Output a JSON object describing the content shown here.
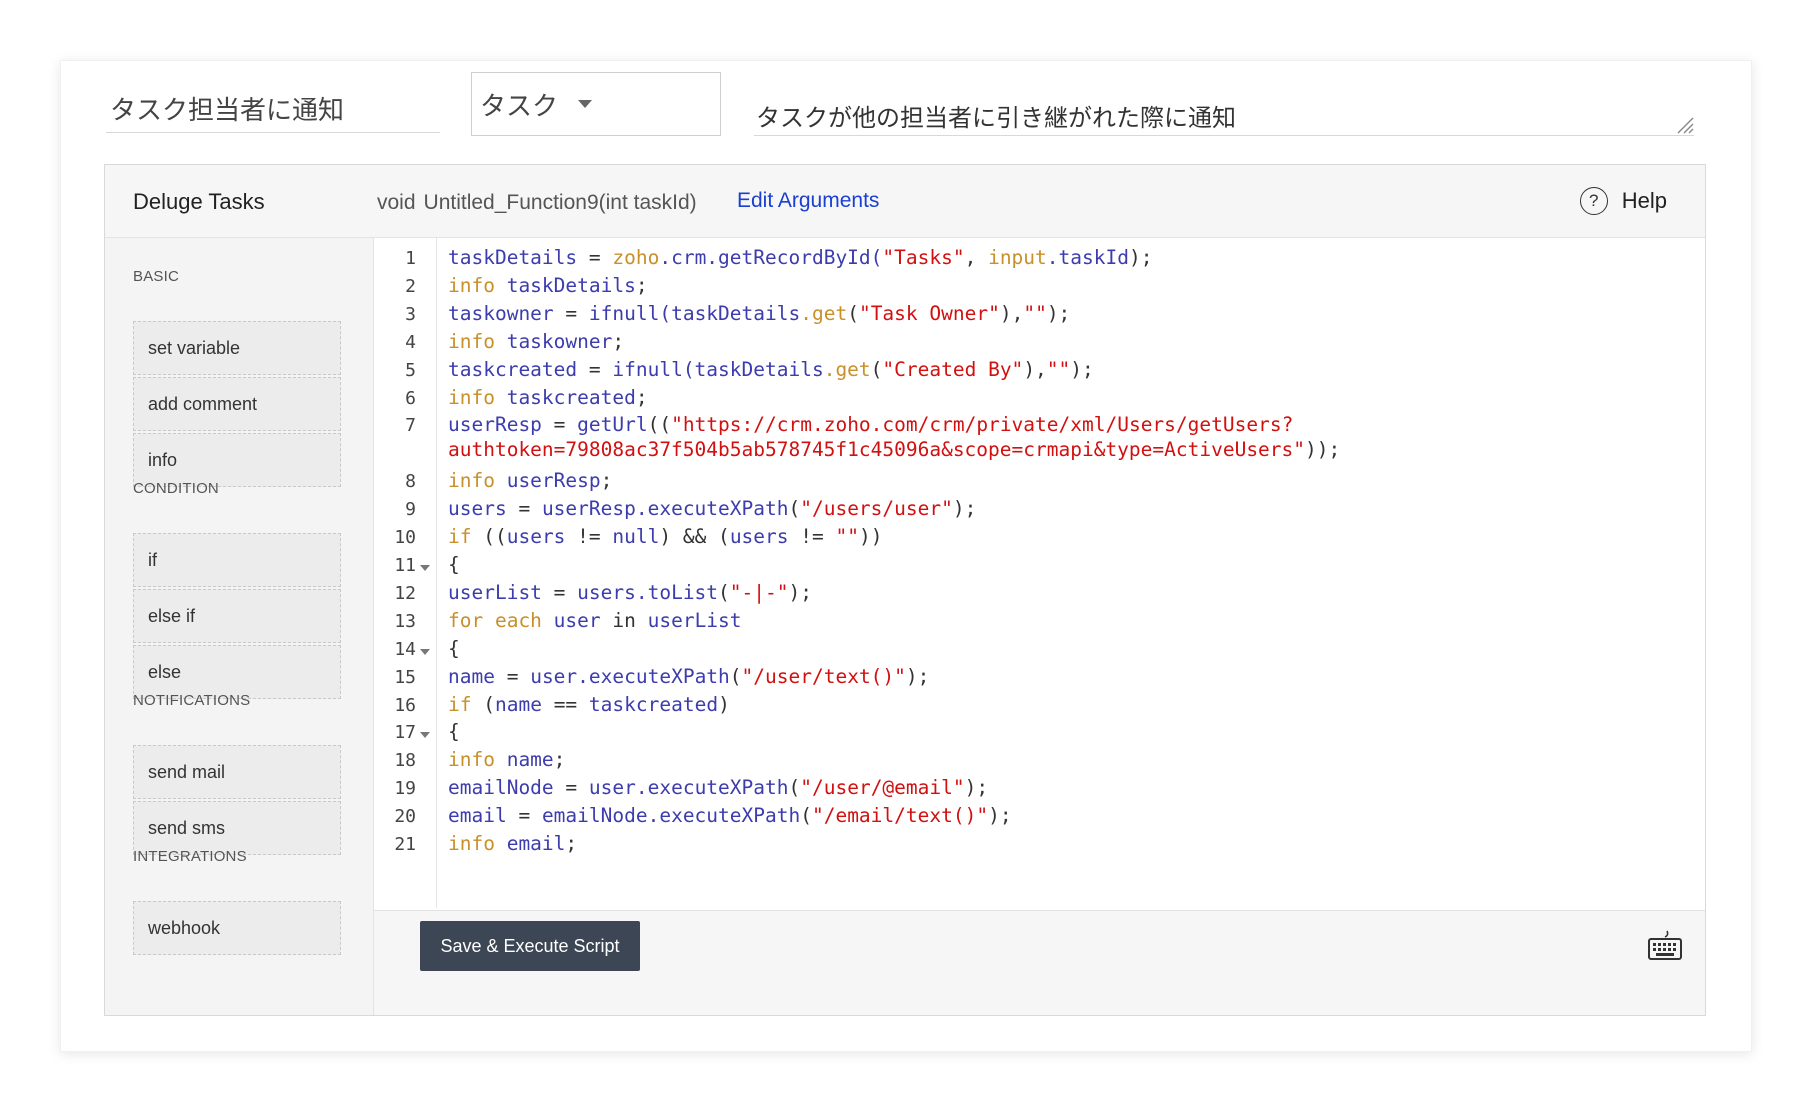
{
  "top": {
    "function_name": "タスク担当者に通知",
    "module": "タスク",
    "description": "タスクが他の担当者に引き継がれた際に通知"
  },
  "editor": {
    "title": "Deluge Tasks",
    "return_type": "void",
    "function_signature": "Untitled_Function9(int taskId)",
    "edit_arguments": "Edit Arguments",
    "help": "Help",
    "help_icon_glyph": "?",
    "save_button": "Save & Execute Script"
  },
  "sidebar": {
    "sections": [
      {
        "title": "BASIC",
        "items": [
          "set variable",
          "add comment",
          "info"
        ]
      },
      {
        "title": "CONDITION",
        "items": [
          "if",
          "else if",
          "else"
        ]
      },
      {
        "title": "NOTIFICATIONS",
        "items": [
          "send mail",
          "send sms"
        ]
      },
      {
        "title": "INTEGRATIONS",
        "items": [
          "webhook"
        ]
      }
    ]
  },
  "code": {
    "line_numbers": [
      "1",
      "2",
      "3",
      "4",
      "5",
      "6",
      "7",
      "8",
      "9",
      "10",
      "11",
      "12",
      "13",
      "14",
      "15",
      "16",
      "17",
      "18",
      "19",
      "20",
      "21"
    ],
    "folds": [
      "11",
      "14",
      "17"
    ],
    "lines": [
      [
        [
          "v",
          "taskDetails"
        ],
        [
          "p",
          " = "
        ],
        [
          "k",
          "zoho"
        ],
        [
          "v",
          ".crm.getRecordById("
        ],
        [
          "s",
          "\"Tasks\""
        ],
        [
          "p",
          ", "
        ],
        [
          "k",
          "input"
        ],
        [
          "v",
          ".taskId"
        ],
        [
          "p",
          ");"
        ]
      ],
      [
        [
          "k",
          "info "
        ],
        [
          "v",
          "taskDetails"
        ],
        [
          "p",
          ";"
        ]
      ],
      [
        [
          "v",
          "taskowner"
        ],
        [
          "p",
          " = "
        ],
        [
          "v",
          "ifnull(taskDetails"
        ],
        [
          "k",
          ".get"
        ],
        [
          "p",
          "("
        ],
        [
          "s",
          "\"Task Owner\""
        ],
        [
          "p",
          "),"
        ],
        [
          "s",
          "\"\""
        ],
        [
          "p",
          ");"
        ]
      ],
      [
        [
          "k",
          "info "
        ],
        [
          "v",
          "taskowner"
        ],
        [
          "p",
          ";"
        ]
      ],
      [
        [
          "v",
          "taskcreated"
        ],
        [
          "p",
          " = "
        ],
        [
          "v",
          "ifnull(taskDetails"
        ],
        [
          "k",
          ".get"
        ],
        [
          "p",
          "("
        ],
        [
          "s",
          "\"Created By\""
        ],
        [
          "p",
          "),"
        ],
        [
          "s",
          "\"\""
        ],
        [
          "p",
          ");"
        ]
      ],
      [
        [
          "k",
          "info "
        ],
        [
          "v",
          "taskcreated"
        ],
        [
          "p",
          ";"
        ]
      ],
      [
        [
          "v",
          "userResp"
        ],
        [
          "p",
          " = "
        ],
        [
          "v",
          "getUrl"
        ],
        [
          "p",
          "(("
        ],
        [
          "s",
          "\"https://crm.zoho.com/crm/private/xml/Users/getUsers?"
        ]
      ],
      [
        [
          "s",
          "authtoken=79808ac37f504b5ab578745f1c45096a&scope=crmapi&type=ActiveUsers\""
        ],
        [
          "p",
          "));"
        ]
      ],
      [
        [
          "k",
          "info "
        ],
        [
          "v",
          "userResp"
        ],
        [
          "p",
          ";"
        ]
      ],
      [
        [
          "v",
          "users"
        ],
        [
          "p",
          " = "
        ],
        [
          "v",
          "userResp.executeXPath"
        ],
        [
          "p",
          "("
        ],
        [
          "s",
          "\"/users/user\""
        ],
        [
          "p",
          ");"
        ]
      ],
      [
        [
          "k",
          "if "
        ],
        [
          "p",
          "(("
        ],
        [
          "v",
          "users"
        ],
        [
          "p",
          " != "
        ],
        [
          "v",
          "null"
        ],
        [
          "p",
          ") && ("
        ],
        [
          "v",
          "users"
        ],
        [
          "p",
          " != "
        ],
        [
          "s",
          "\"\""
        ],
        [
          "p",
          "))"
        ]
      ],
      [
        [
          "p",
          "{"
        ]
      ],
      [
        [
          "v",
          "userList"
        ],
        [
          "p",
          " = "
        ],
        [
          "v",
          "users.toList"
        ],
        [
          "p",
          "("
        ],
        [
          "s",
          "\"-|-\""
        ],
        [
          "p",
          ");"
        ]
      ],
      [
        [
          "k",
          "for each "
        ],
        [
          "v",
          "user"
        ],
        [
          "p",
          " in "
        ],
        [
          "v",
          "userList"
        ]
      ],
      [
        [
          "p",
          "{"
        ]
      ],
      [
        [
          "v",
          "name"
        ],
        [
          "p",
          " = "
        ],
        [
          "v",
          "user.executeXPath"
        ],
        [
          "p",
          "("
        ],
        [
          "s",
          "\"/user/text()\""
        ],
        [
          "p",
          ");"
        ]
      ],
      [
        [
          "k",
          "if "
        ],
        [
          "p",
          "("
        ],
        [
          "v",
          "name"
        ],
        [
          "p",
          " == "
        ],
        [
          "v",
          "taskcreated"
        ],
        [
          "p",
          ")"
        ]
      ],
      [
        [
          "p",
          "{"
        ]
      ],
      [
        [
          "k",
          "info "
        ],
        [
          "v",
          "name"
        ],
        [
          "p",
          ";"
        ]
      ],
      [
        [
          "v",
          "emailNode"
        ],
        [
          "p",
          " = "
        ],
        [
          "v",
          "user.executeXPath"
        ],
        [
          "p",
          "("
        ],
        [
          "s",
          "\"/user/@email\""
        ],
        [
          "p",
          ");"
        ]
      ],
      [
        [
          "v",
          "email"
        ],
        [
          "p",
          " = "
        ],
        [
          "v",
          "emailNode.executeXPath"
        ],
        [
          "p",
          "("
        ],
        [
          "s",
          "\"/email/text()\""
        ],
        [
          "p",
          ");"
        ]
      ],
      [
        [
          "k",
          "info "
        ],
        [
          "v",
          "email"
        ],
        [
          "p",
          ";"
        ]
      ]
    ]
  },
  "colors": {
    "variable": "#3c3cae",
    "keyword": "#c8902a",
    "string": "#d21010",
    "save_button_bg": "#3c4654",
    "link": "#1a3fd1"
  },
  "icons": {
    "help": "help-circle-icon",
    "keyboard": "keyboard-icon",
    "fold": "fold-arrow-icon",
    "dropdown": "chevron-down-icon",
    "resize": "resize-handle-icon"
  }
}
